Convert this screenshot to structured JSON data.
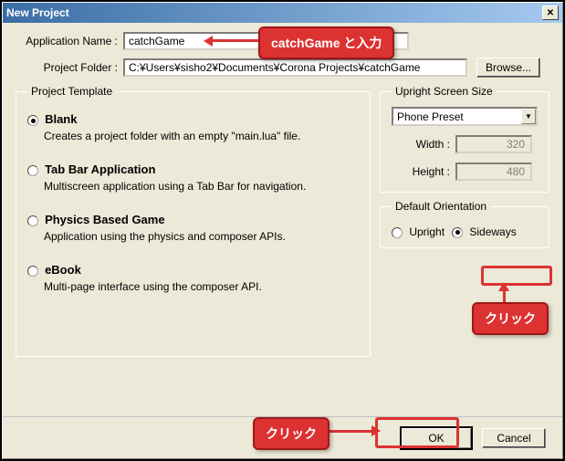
{
  "titlebar": {
    "title": "New Project"
  },
  "form": {
    "app_name_label": "Application Name :",
    "app_name_value": "catchGame",
    "folder_label": "Project Folder :",
    "folder_value": "C:¥Users¥sisho2¥Documents¥Corona Projects¥catchGame",
    "browse_label": "Browse..."
  },
  "template": {
    "legend": "Project Template",
    "options": [
      {
        "title": "Blank",
        "desc": "Creates a project folder with an empty \"main.lua\" file.",
        "selected": true
      },
      {
        "title": "Tab Bar Application",
        "desc": "Multiscreen application using a Tab Bar for navigation.",
        "selected": false
      },
      {
        "title": "Physics Based Game",
        "desc": "Application using the physics and composer APIs.",
        "selected": false
      },
      {
        "title": "eBook",
        "desc": "Multi-page interface using the composer API.",
        "selected": false
      }
    ]
  },
  "screen_size": {
    "legend": "Upright Screen Size",
    "preset_value": "Phone Preset",
    "width_label": "Width :",
    "width_value": "320",
    "height_label": "Height :",
    "height_value": "480"
  },
  "orientation": {
    "legend": "Default Orientation",
    "upright": "Upright",
    "sideways": "Sideways",
    "selected": "sideways"
  },
  "buttons": {
    "ok": "OK",
    "cancel": "Cancel"
  },
  "annotations": {
    "input_text": "catchGame と入力",
    "click_sideways": "クリック",
    "click_ok": "クリック"
  }
}
